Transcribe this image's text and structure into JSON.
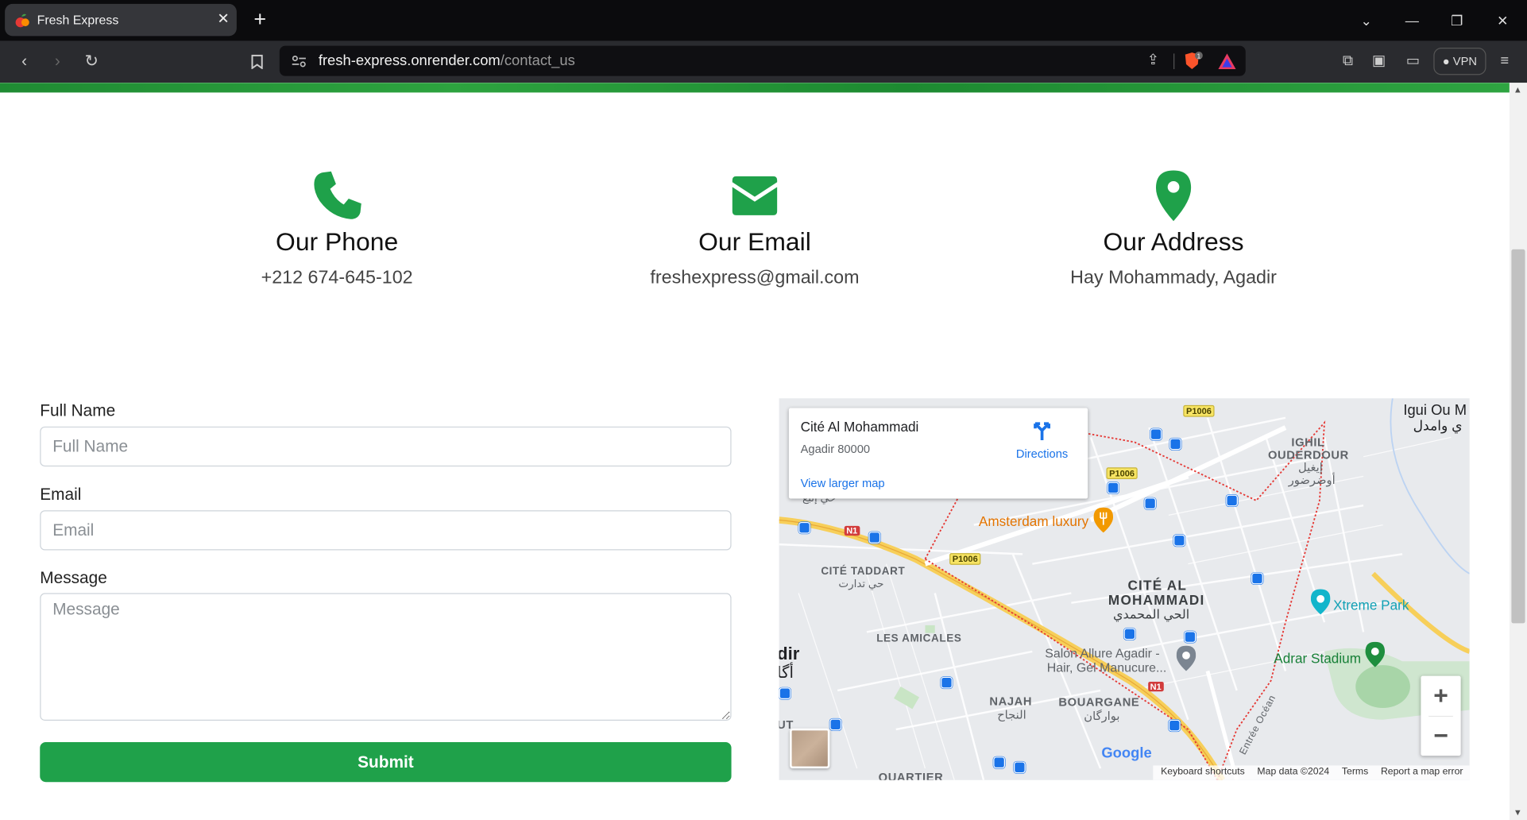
{
  "browser": {
    "tab_title": "Fresh Express",
    "url_host": "fresh-express.onrender.com",
    "url_path": "/contact_us",
    "vpn_label": "VPN",
    "shield_badge": "1"
  },
  "contact": {
    "phone": {
      "title": "Our Phone",
      "value": "+212 674-645-102",
      "icon": "phone-icon"
    },
    "email": {
      "title": "Our Email",
      "value": "freshexpress@gmail.com",
      "icon": "envelope-icon"
    },
    "address": {
      "title": "Our Address",
      "value": "Hay Mohammady, Agadir",
      "icon": "map-pin-icon"
    },
    "accent_color": "#1fa14a"
  },
  "form": {
    "name_label": "Full Name",
    "name_placeholder": "Full Name",
    "email_label": "Email",
    "email_placeholder": "Email",
    "message_label": "Message",
    "message_placeholder": "Message",
    "submit_label": "Submit"
  },
  "map": {
    "place_name": "Cité Al Mohammadi",
    "place_address": "Agadir 80000",
    "directions_label": "Directions",
    "larger_map_label": "View larger map",
    "labels": {
      "igui": "Igui Ou M",
      "igui_ar": "ي وامدل",
      "ighil1": "IGHIL",
      "ighil2": "OUDERDOUR",
      "ighil_ar": "إيغيل",
      "ighil_ar2": "أوضرضور",
      "taddart": "CITÉ TADDART",
      "taddart_ar": "حي تدارت",
      "cite1": "CITÉ AL",
      "cite2": "MOHAMMADI",
      "cite_ar": "الحي المحمدي",
      "amicales": "LES AMICALES",
      "najah": "NAJAH",
      "najah_ar": "النجاح",
      "bouargane": "BOUARGANE",
      "bouargane_ar": "بوارگان",
      "quartier": "QUARTIER",
      "dir": "dir",
      "dir_ar": "أگا",
      "ut": "UT",
      "top_ar": "حي إنبع",
      "amsterdam": "Amsterdam luxury",
      "salon1": "Salon Allure Agadir -",
      "salon2": "Hair, Gel Manucure...",
      "xtreme": "Xtreme Park",
      "adrar": "Adrar Stadium",
      "entree": "Entrée Océan",
      "p1006": "P1006",
      "n1": "N1"
    },
    "google": "Google",
    "attribution": [
      "Keyboard shortcuts",
      "Map data ©2024",
      "Terms",
      "Report a map error"
    ]
  }
}
